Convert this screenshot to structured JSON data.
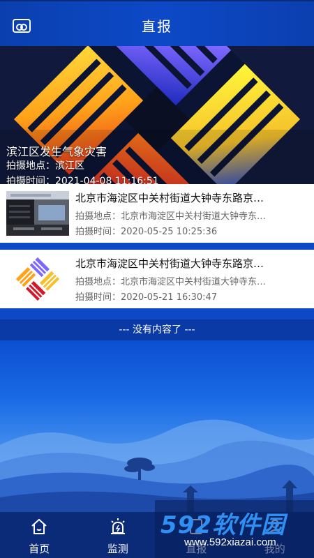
{
  "header": {
    "title": "直报"
  },
  "featured": {
    "title": "滨江区发生气象灾害",
    "location_line": "拍摄地点：滨江区",
    "time_line": "拍摄时间：2021-04-08 11:16:51"
  },
  "items": [
    {
      "title": "北京市海淀区中关村街道大钟寺东路京…",
      "location_label": "拍摄地点：",
      "location": "北京市海淀区中关村街道大钟寺东…",
      "time_label": "拍摄时间：",
      "time": "2020-05-25 10:25:36"
    },
    {
      "title": "北京市海淀区中关村街道大钟寺东路京…",
      "location_label": "拍摄地点：",
      "location": "北京市海淀区中关村街道大钟寺东…",
      "time_label": "拍摄时间：",
      "time": "2020-05-21 16:30:47"
    }
  ],
  "no_more": "--- 没有内容了 ---",
  "tabbar": {
    "tabs": [
      {
        "label": "首页",
        "icon": "home-icon"
      },
      {
        "label": "监测",
        "icon": "alarm-icon"
      },
      {
        "label": "直报",
        "icon": "report-icon"
      },
      {
        "label": "我的",
        "icon": "user-icon"
      }
    ]
  },
  "watermark": {
    "logo": "592软件园",
    "url": "www.592xiazai.com"
  },
  "colors": {
    "header_bg": "#0d49c7",
    "tabbar_bg": "#0b2a78",
    "accent": "#2f8ff2"
  }
}
